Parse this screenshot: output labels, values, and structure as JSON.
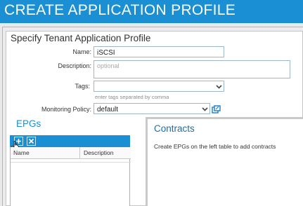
{
  "window": {
    "title": "CREATE APPLICATION PROFILE",
    "accent": "#1a8fd3"
  },
  "form": {
    "heading": "Specify Tenant Application Profile",
    "name_label": "Name:",
    "name_value": "iSCSI",
    "description_label": "Description:",
    "description_placeholder": "optional",
    "tags_label": "Tags:",
    "tags_value": "",
    "tags_hint": "enter tags separated by comma",
    "monitoring_label": "Monitoring Policy:",
    "monitoring_value": "default"
  },
  "epgs": {
    "heading": "EPGs",
    "toolbar": {
      "add_icon": "add-icon",
      "delete_icon": "delete-icon"
    },
    "columns": [
      "Name",
      "Description"
    ],
    "rows": []
  },
  "contracts": {
    "heading": "Contracts",
    "message": "Create EPGs on the left table to add contracts"
  }
}
